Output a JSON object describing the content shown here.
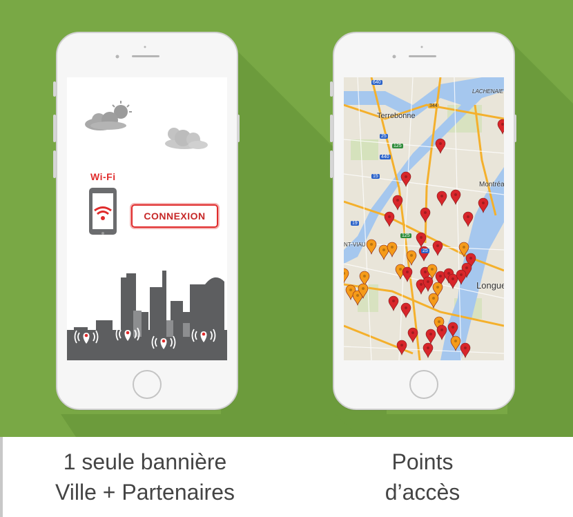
{
  "banner": {
    "background_color": "#79a845",
    "shadow_color": "#6a9a3a"
  },
  "phone_left": {
    "screen": {
      "wifi_label": "Wi-Fi",
      "connect_label": "CONNEXION",
      "accent_color": "#e02b2b",
      "city_color": "#5d5e60"
    },
    "caption": {
      "line1": "1 seule bannière",
      "line2": "Ville + Partenaires"
    }
  },
  "phone_right": {
    "map": {
      "places": [
        "Terrebonne",
        "LACHENAIE",
        "Montréal",
        "NT-VIAU",
        "Longue"
      ],
      "highway_shields": [
        "640",
        "25",
        "125",
        "440",
        "15",
        "19",
        "125",
        "25",
        "344"
      ],
      "pin_colors": [
        "#d8262b",
        "#f59b1a"
      ]
    },
    "caption": {
      "line1": "Points",
      "line2": "d’accès"
    }
  }
}
